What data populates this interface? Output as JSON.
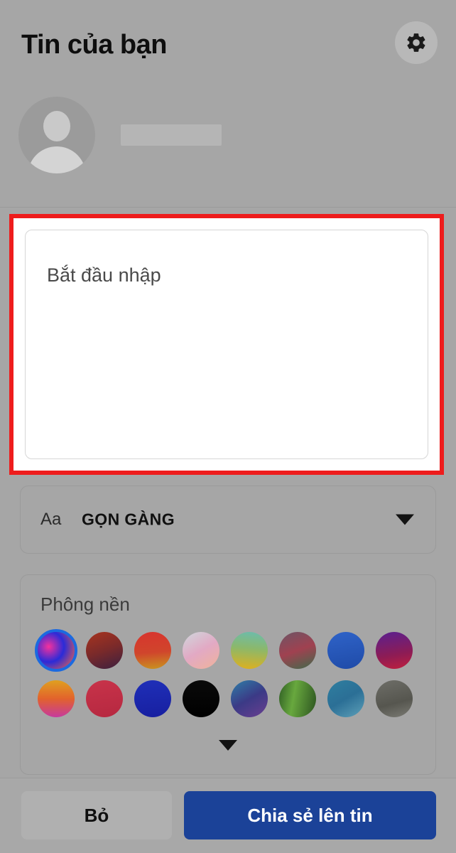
{
  "header": {
    "title": "Tin của bạn",
    "settings_icon": "gear-icon",
    "avatar_icon": "person-avatar-icon",
    "profile_name": ""
  },
  "composer": {
    "placeholder": "Bắt đầu nhập",
    "value": "",
    "highlight_color": "#ee1c1c"
  },
  "style_selector": {
    "icon_label": "Aa",
    "value": "GỌN GÀNG",
    "caret_icon": "chevron-down-icon"
  },
  "background": {
    "label": "Phông nền",
    "expand_icon": "chevron-down-icon",
    "selected_index": 0,
    "swatches": [
      {
        "name": "swatch-neon-swirl",
        "selected": true,
        "css": "radial-gradient(circle at 30% 40%, #f5319d 0%, #2b2bd8 45%, #ff6a3d 100%)"
      },
      {
        "name": "swatch-dark-red-brown",
        "selected": false,
        "css": "linear-gradient(160deg, #a8341f 0%, #7a2a2a 50%, #3c2040 100%)"
      },
      {
        "name": "swatch-red-orange",
        "selected": false,
        "css": "linear-gradient(175deg, #d8342e 0%, #d0452c 55%, #c9961f 100%)"
      },
      {
        "name": "swatch-pastel-peach",
        "selected": false,
        "css": "linear-gradient(150deg, #cfd8dd 0%, #e2a9c4 50%, #f0b39a 100%)"
      },
      {
        "name": "swatch-teal-yellow",
        "selected": false,
        "css": "linear-gradient(185deg, #6bbcae 0%, #8cb86a 45%, #e0b01d 100%)"
      },
      {
        "name": "swatch-mauve-green",
        "selected": false,
        "css": "linear-gradient(160deg, #6d5566 0%, #a04150 50%, #3f6b4c 100%)"
      },
      {
        "name": "swatch-blue",
        "selected": false,
        "css": "linear-gradient(170deg, #2f63c8 0%, #1f4ba8 100%)"
      },
      {
        "name": "swatch-purple-crimson",
        "selected": false,
        "css": "linear-gradient(170deg, #5a2090 0%, #8d1c55 60%, #c01f3e 100%)"
      },
      {
        "name": "swatch-orange-magenta",
        "selected": false,
        "css": "linear-gradient(180deg, #e0a020 0%, #e2622c 50%, #c63a9e 100%)"
      },
      {
        "name": "swatch-crimson",
        "selected": false,
        "css": "linear-gradient(170deg, #c8334a 0%, #b62840 100%)"
      },
      {
        "name": "swatch-deep-blue",
        "selected": false,
        "css": "linear-gradient(175deg, #1f2fb8 0%, #171fa0 100%)"
      },
      {
        "name": "swatch-black",
        "selected": false,
        "css": "linear-gradient(180deg, #0a0a0a 0%, #000000 100%)"
      },
      {
        "name": "swatch-blue-violet",
        "selected": false,
        "css": "linear-gradient(150deg, #2e7fa8 0%, #3b3a86 50%, #6a3f90 100%)"
      },
      {
        "name": "swatch-green-leaves",
        "selected": false,
        "css": "linear-gradient(100deg, #2f5e24 0%, #68a83e 40%, #2c5420 100%)"
      },
      {
        "name": "swatch-teal-ocean",
        "selected": false,
        "css": "linear-gradient(150deg, #2f7fa0 0%, #2b6f96 50%, #5ea0b8 100%)"
      },
      {
        "name": "swatch-grey-stone",
        "selected": false,
        "css": "linear-gradient(165deg, #6e6e68 0%, #56564f 60%, #7b7b74 100%)"
      }
    ]
  },
  "footer": {
    "discard_label": "Bỏ",
    "share_label": "Chia sẻ lên tin",
    "share_color": "#1b4298"
  }
}
